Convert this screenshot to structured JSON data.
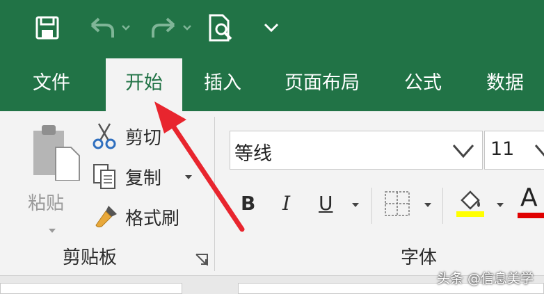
{
  "quick_access": {
    "icons": [
      "save-icon",
      "undo-icon",
      "redo-icon",
      "print-preview-icon",
      "customize-dropdown-icon"
    ]
  },
  "tabs": [
    {
      "label": "文件"
    },
    {
      "label": "开始",
      "active": true
    },
    {
      "label": "插入"
    },
    {
      "label": "页面布局"
    },
    {
      "label": "公式"
    },
    {
      "label": "数据"
    }
  ],
  "clipboard": {
    "paste_label": "粘贴",
    "cut_label": "剪切",
    "copy_label": "复制",
    "format_painter_label": "格式刷",
    "group_label": "剪贴板"
  },
  "font": {
    "font_name": "等线",
    "font_size": "11",
    "bold": "B",
    "italic": "I",
    "underline": "U",
    "font_color_glyph": "A",
    "group_label": "字体"
  },
  "colors": {
    "excel_green": "#217346",
    "fill_yellow": "#ffff00",
    "font_red": "#e00000",
    "arrow_red": "#e8252e"
  },
  "watermark": "头条 @信息美学"
}
